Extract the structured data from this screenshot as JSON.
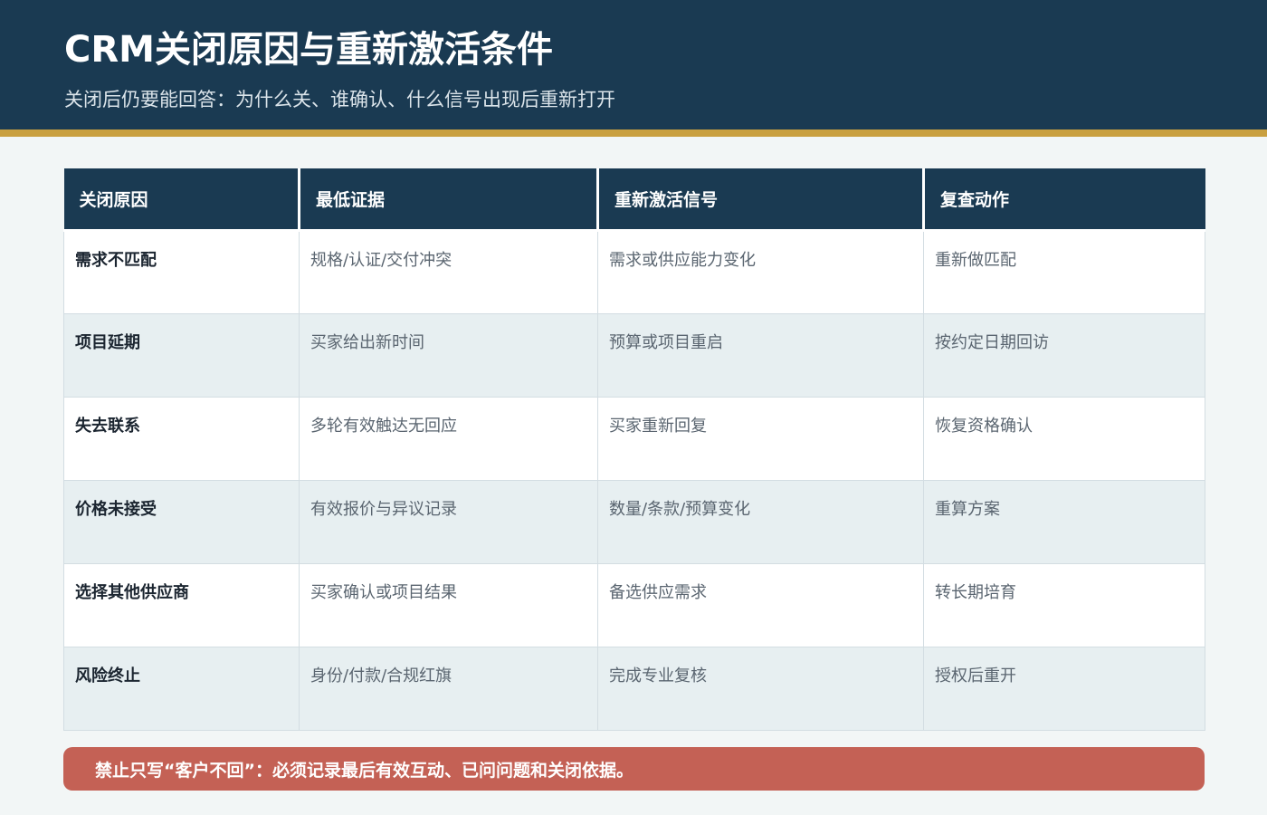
{
  "header": {
    "title": "CRM关闭原因与重新激活条件",
    "subtitle": "关闭后仍要能回答：为什么关、谁确认、什么信号出现后重新打开"
  },
  "table": {
    "columns": [
      "关闭原因",
      "最低证据",
      "重新激活信号",
      "复查动作"
    ],
    "rows": [
      [
        "需求不匹配",
        "规格/认证/交付冲突",
        "需求或供应能力变化",
        "重新做匹配"
      ],
      [
        "项目延期",
        "买家给出新时间",
        "预算或项目重启",
        "按约定日期回访"
      ],
      [
        "失去联系",
        "多轮有效触达无回应",
        "买家重新回复",
        "恢复资格确认"
      ],
      [
        "价格未接受",
        "有效报价与异议记录",
        "数量/条款/预算变化",
        "重算方案"
      ],
      [
        "选择其他供应商",
        "买家确认或项目结果",
        "备选供应需求",
        "转长期培育"
      ],
      [
        "风险终止",
        "身份/付款/合规红旗",
        "完成专业复核",
        "授权后重开"
      ]
    ]
  },
  "banner": {
    "text": "禁止只写“客户不回”：必须记录最后有效互动、已问问题和关闭依据。"
  },
  "colors": {
    "header_bg": "#1a3a52",
    "accent_rule": "#c9a040",
    "banner_bg": "#c46155"
  }
}
